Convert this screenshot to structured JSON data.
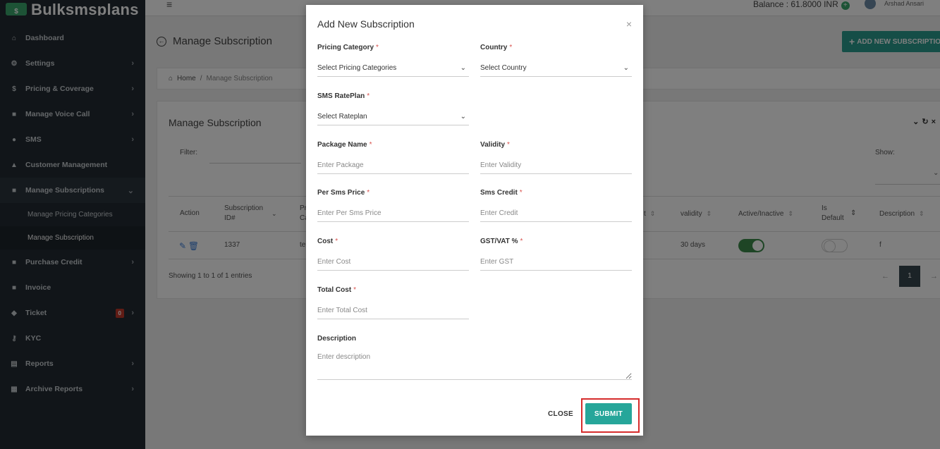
{
  "app": {
    "logo": "Bulksmsplans"
  },
  "topbar": {
    "balance": "Balance : 61.8000 INR",
    "user": "Arshad Ansari"
  },
  "sidebar": {
    "items": [
      {
        "label": "Dashboard",
        "icon": "home-icon"
      },
      {
        "label": "Settings",
        "icon": "cogs-icon"
      },
      {
        "label": "Pricing & Coverage",
        "icon": "dollar-icon"
      },
      {
        "label": "Manage Voice Call",
        "icon": "list-icon"
      },
      {
        "label": "SMS",
        "icon": "chat-icon"
      },
      {
        "label": "Customer Management",
        "icon": "user-icon"
      },
      {
        "label": "Manage Subscriptions",
        "icon": "list-icon"
      },
      {
        "label": "Purchase Credit",
        "icon": "list-icon"
      },
      {
        "label": "Invoice",
        "icon": "list-icon"
      },
      {
        "label": "Ticket",
        "icon": "tag-icon",
        "badge": "0"
      },
      {
        "label": "KYC",
        "icon": "key-icon"
      },
      {
        "label": "Reports",
        "icon": "file-icon"
      },
      {
        "label": "Archive Reports",
        "icon": "calendar-icon"
      }
    ],
    "sub_items": [
      "Manage Pricing Categories",
      "Manage Subscription"
    ]
  },
  "page": {
    "title": "Manage Subscription",
    "add_button": "ADD NEW SUBSCRIPTION",
    "breadcrumb": {
      "home": "Home",
      "sep": "/",
      "current": "Manage Subscription"
    }
  },
  "card": {
    "title": "Manage Subscription",
    "filter_label": "Filter:",
    "show_label": "Show:",
    "columns": [
      "Action",
      "Subscription ID#",
      "Pr Ca",
      "t",
      "validity",
      "Active/Inactive",
      "Is Default",
      "Description"
    ],
    "row": {
      "id": "1337",
      "category": "te",
      "validity": "30 days",
      "active": true,
      "is_default": false,
      "description": "f"
    },
    "showing": "Showing 1 to 1 of 1 entries",
    "pager": {
      "prev": "←",
      "page": "1",
      "next": "→"
    }
  },
  "modal": {
    "title": "Add New Subscription",
    "close_icon": "×",
    "fields": {
      "pricing_category": {
        "label": "Pricing Category",
        "value": "Select Pricing Categories"
      },
      "country": {
        "label": "Country",
        "value": "Select Country"
      },
      "rateplan": {
        "label": "SMS RatePlan",
        "value": "Select Rateplan"
      },
      "package_name": {
        "label": "Package Name",
        "placeholder": "Enter Package"
      },
      "validity": {
        "label": "Validity",
        "placeholder": "Enter Validity"
      },
      "per_sms_price": {
        "label": "Per Sms Price",
        "placeholder": "Enter Per Sms Price"
      },
      "sms_credit": {
        "label": "Sms Credit",
        "placeholder": "Enter Credit"
      },
      "cost": {
        "label": "Cost",
        "placeholder": "Enter Cost"
      },
      "gst": {
        "label": "GST/VAT %",
        "placeholder": "Enter GST"
      },
      "total_cost": {
        "label": "Total Cost",
        "placeholder": "Enter Total Cost"
      },
      "description": {
        "label": "Description",
        "placeholder": "Enter description"
      }
    },
    "required_mark": "*",
    "close_label": "CLOSE",
    "submit_label": "SUBMIT"
  },
  "colors": {
    "sidebar": "#232b32",
    "accent": "#26a69a",
    "highlight": "#d62c2c"
  }
}
